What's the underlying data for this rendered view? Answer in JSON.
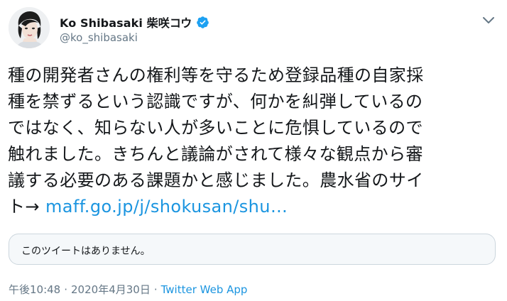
{
  "user": {
    "display_name": "Ko Shibasaki 柴咲コウ",
    "handle": "@ko_shibasaki",
    "verified_color": "#1da1f2"
  },
  "tweet": {
    "text_lines": [
      "種の開発者さんの権利等を守るため登録品種の自家採",
      "種を禁ずるという認識ですが、何かを糾弾しているの",
      "ではなく、知らない人が多いことに危惧しているので",
      "触れました。きちんと議論がされて様々な観点から審",
      "議する必要のある課題かと感じました。農水省のサイ"
    ],
    "last_line_prefix": "ト→ ",
    "link_text": "maff.go.jp/j/shokusan/shu…",
    "link_color": "#1b95e0"
  },
  "quoted": {
    "unavailable_text": "このツイートはありません。"
  },
  "meta": {
    "time": "午後10:48",
    "separator": "·",
    "date": "2020年4月30日",
    "source": "Twitter Web App"
  }
}
